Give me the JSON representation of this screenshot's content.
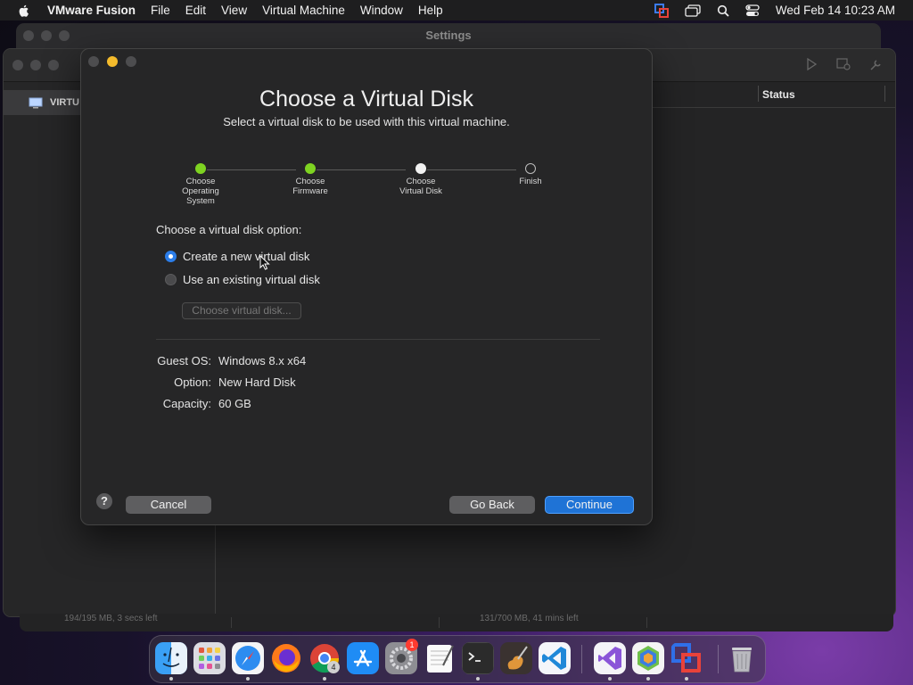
{
  "menubar": {
    "app_name": "VMware Fusion",
    "items": [
      "File",
      "Edit",
      "View",
      "Virtual Machine",
      "Window",
      "Help"
    ],
    "clock": "Wed Feb 14  10:23 AM"
  },
  "settings_window": {
    "title": "Settings"
  },
  "library_window": {
    "sidebar_item": "VIRTU",
    "status_column": "Status",
    "bottom_left": "194/195 MB, 3 secs left",
    "bottom_right": "131/700 MB, 41 mins left"
  },
  "dialog": {
    "title": "Choose a Virtual Disk",
    "subtitle": "Select a virtual disk to be used with this virtual machine.",
    "steps": [
      {
        "label": "Choose Operating System",
        "state": "done"
      },
      {
        "label": "Choose Firmware",
        "state": "done"
      },
      {
        "label": "Choose Virtual Disk",
        "state": "current"
      },
      {
        "label": "Finish",
        "state": "todo"
      }
    ],
    "option_heading": "Choose a virtual disk option:",
    "options": [
      {
        "label": "Create a new virtual disk",
        "selected": true
      },
      {
        "label": "Use an existing virtual disk",
        "selected": false
      }
    ],
    "choose_disk_button": "Choose virtual disk...",
    "summary": [
      {
        "key": "Guest OS:",
        "value": "Windows 8.x x64"
      },
      {
        "key": "Option:",
        "value": "New Hard Disk"
      },
      {
        "key": "Capacity:",
        "value": "60 GB"
      }
    ],
    "help_label": "?",
    "cancel_label": "Cancel",
    "back_label": "Go Back",
    "continue_label": "Continue"
  },
  "dock": {
    "apps": [
      "finder-icon",
      "launchpad-icon",
      "safari-icon",
      "firefox-icon",
      "chrome-icon",
      "app-store-icon",
      "system-settings-icon",
      "textedit-icon",
      "terminal-icon",
      "garageband-icon",
      "vscode-icon",
      "visual-studio-icon",
      "android-studio-icon",
      "vmware-fusion-icon",
      "trash-icon"
    ],
    "settings_badge": "1",
    "chrome_badge": "4"
  },
  "colors": {
    "accent": "#1f73d6",
    "step_done": "#7ed321",
    "minimize": "#f4bb2c"
  }
}
